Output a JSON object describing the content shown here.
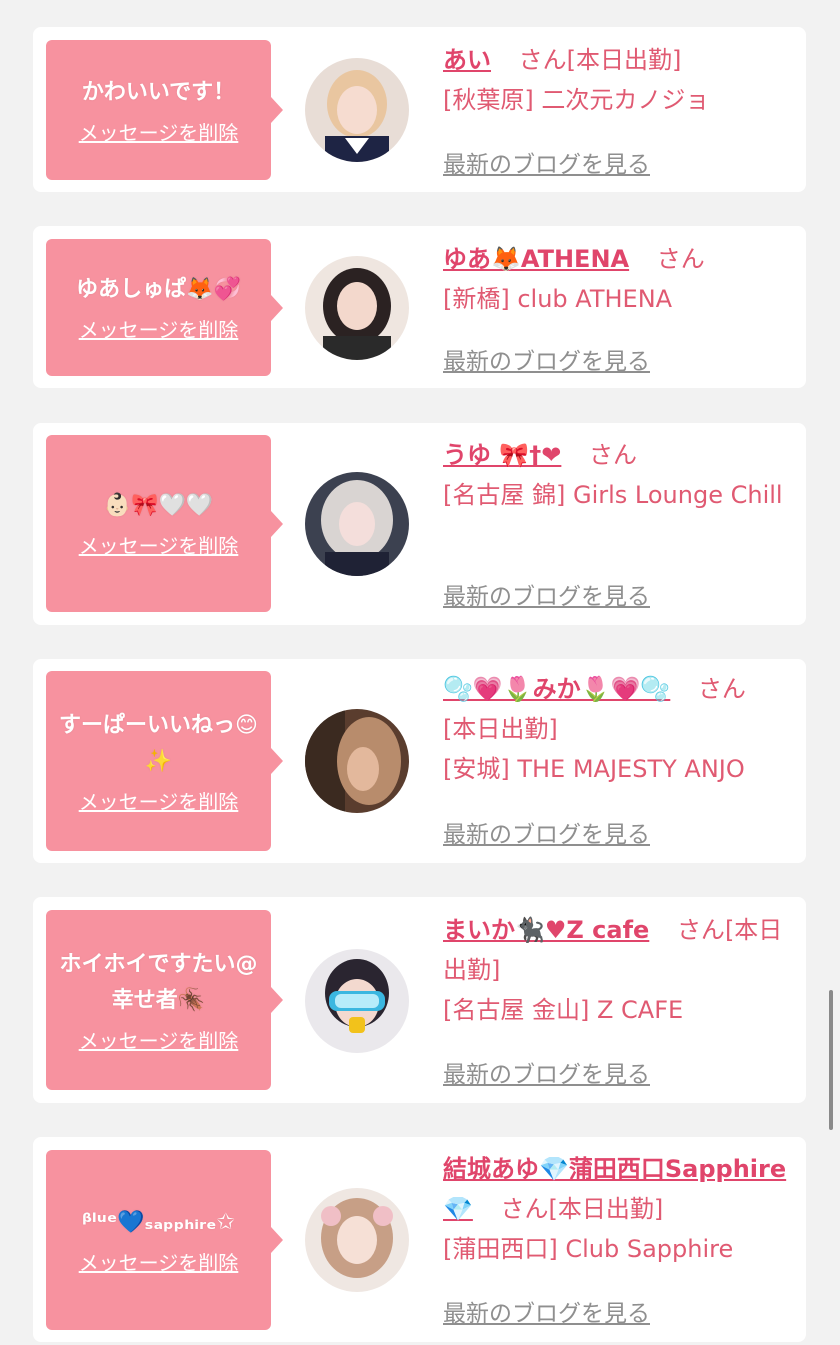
{
  "delete_label": "メッセージを削除",
  "blog_label": "最新のブログを見る",
  "san": "さん",
  "cards": [
    {
      "message": "かわいいです！",
      "name": "あい",
      "status": "[本日出勤]",
      "shop": "[秋葉原] 二次元カノジョ"
    },
    {
      "message": "ゆあしゅぱ🦊💞",
      "name": "ゆあ🦊ATHENA",
      "status": "",
      "shop": "[新橋] club ATHENA"
    },
    {
      "message": "👶🏻🎀🤍🤍",
      "name": "うゆ 🎀†❤",
      "status": "",
      "shop": "[名古屋 錦] Girls Lounge Chill"
    },
    {
      "message": "すーぱーいいねっ😊✨",
      "name": "🫧💗🌷みか🌷💗🫧",
      "status": "[本日出勤]",
      "shop": "[安城] THE MAJESTY ANJO"
    },
    {
      "message": "ホイホイですたい@幸せ者🪳",
      "name": "まいか🐈‍⬛♥Z cafe",
      "status": "[本日出勤]",
      "shop": "[名古屋 金山] Z CAFE"
    },
    {
      "message": "ᵝˡᵘᵉ💙ₛₐₚₚₕᵢᵣₑ✩",
      "name": "結城あゆ💎蒲田西口Sapphire💎",
      "status": "[本日出勤]",
      "shop": "[蒲田西口] Club Sapphire"
    }
  ]
}
